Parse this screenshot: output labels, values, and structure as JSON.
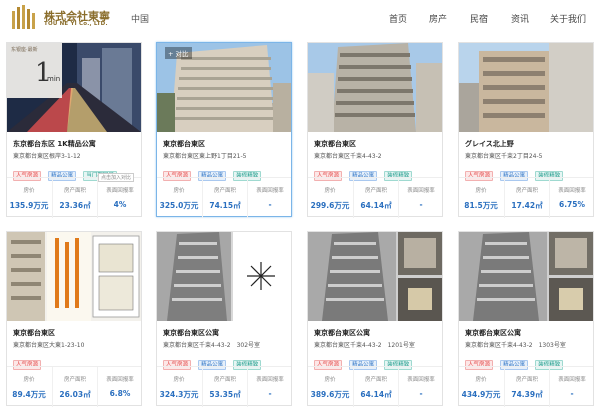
{
  "header": {
    "logo_cn": "株式会社東寧",
    "logo_en": "TOU NE YI Co., LTD.",
    "region": "中国",
    "nav": [
      "首页",
      "房产",
      "民宿",
      "资讯",
      "关于我们"
    ]
  },
  "stat_labels": {
    "price": "房价",
    "area": "房产面积",
    "ratio": "表面回报率"
  },
  "compare_label": "+ 对比",
  "tooltip": "点击加入对比",
  "cards": [
    {
      "title": "东京都台东区 1K精品公寓",
      "address": "東京都台東区根岸3-1-12",
      "tags": [
        {
          "text": "人气房源",
          "style": "red"
        },
        {
          "text": "精品公寓",
          "style": "blue"
        },
        {
          "text": "当门期回报",
          "style": "teal"
        }
      ],
      "price": "135.9万元",
      "area": "23.36㎡",
      "ratio": "4%",
      "photo_banner": {
        "top": "东银座·最新",
        "big": "1",
        "unit": "min"
      }
    },
    {
      "title": "東京都台東区",
      "address": "東京都台東区東上野1丁目21-5",
      "tags": [
        {
          "text": "人气房源",
          "style": "red"
        },
        {
          "text": "精品公寓",
          "style": "blue"
        },
        {
          "text": "装修精致",
          "style": "teal"
        }
      ],
      "price": "325.0万元",
      "area": "74.15㎡",
      "ratio": "-"
    },
    {
      "title": "東京都台東区",
      "address": "東京都台東区千束4-43-2",
      "tags": [
        {
          "text": "人气房源",
          "style": "red"
        },
        {
          "text": "精品公寓",
          "style": "blue"
        },
        {
          "text": "装修精致",
          "style": "teal"
        }
      ],
      "price": "299.6万元",
      "area": "64.14㎡",
      "ratio": "-"
    },
    {
      "title": "グレイス北上野",
      "address": "東京都台東区千束2丁目24-5",
      "tags": [
        {
          "text": "人气房源",
          "style": "red"
        },
        {
          "text": "精品公寓",
          "style": "blue"
        },
        {
          "text": "装修精致",
          "style": "teal"
        }
      ],
      "price": "81.5万元",
      "area": "17.42㎡",
      "ratio": "6.75%"
    },
    {
      "title": "東京都台東区",
      "address": "東京都台東区大東1-23-10",
      "tags": [
        {
          "text": "人气房源",
          "style": "red"
        }
      ],
      "price": "89.4万元",
      "area": "26.03㎡",
      "ratio": "6.8%"
    },
    {
      "title": "東京都台東区公寓",
      "address": "東京都台東区千束4-43-2　302号室",
      "tags": [
        {
          "text": "人气房源",
          "style": "red"
        },
        {
          "text": "精品公寓",
          "style": "blue"
        },
        {
          "text": "装修精致",
          "style": "teal"
        }
      ],
      "price": "324.3万元",
      "area": "53.35㎡",
      "ratio": "-"
    },
    {
      "title": "東京都台東区公寓",
      "address": "東京都台東区千束4-43-2　1201号室",
      "tags": [
        {
          "text": "人气房源",
          "style": "red"
        },
        {
          "text": "精品公寓",
          "style": "blue"
        },
        {
          "text": "装修精致",
          "style": "teal"
        }
      ],
      "price": "389.6万元",
      "area": "64.14㎡",
      "ratio": "-"
    },
    {
      "title": "東京都台東区公寓",
      "address": "東京都台東区千束4-43-2　1303号室",
      "tags": [
        {
          "text": "人气房源",
          "style": "red"
        },
        {
          "text": "精品公寓",
          "style": "blue"
        },
        {
          "text": "装修精致",
          "style": "teal"
        }
      ],
      "price": "434.9万元",
      "area": "74.39㎡",
      "ratio": "-"
    }
  ],
  "colors": {
    "accent": "#2a6fbf",
    "logo_gold": "#8a6d2b",
    "selected_border": "#7bb5e8"
  }
}
